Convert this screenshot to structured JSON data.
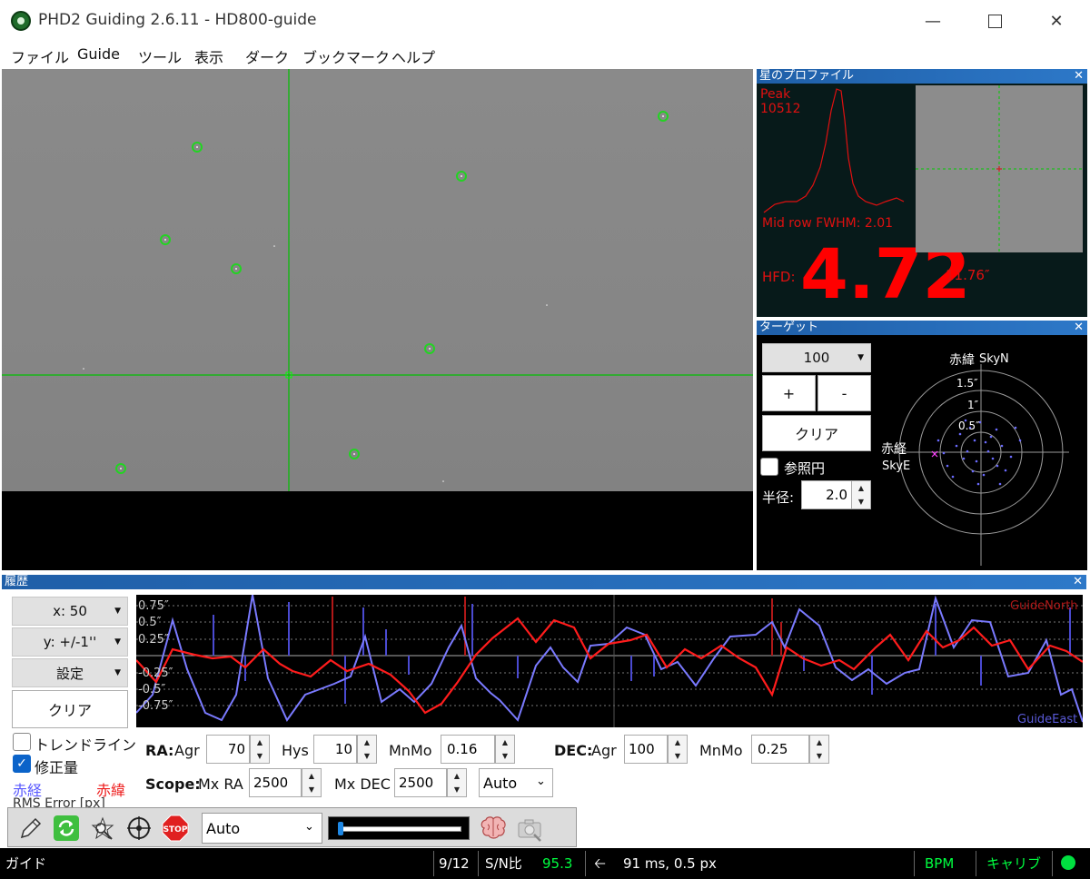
{
  "window": {
    "title": "PHD2 Guiding 2.6.11 - HD800-guide"
  },
  "menu": [
    "ファイル",
    "Guide",
    "ツール",
    "表示",
    "ダーク",
    "ブックマーク",
    "ヘルプ"
  ],
  "profile": {
    "title": "星のプロファイル",
    "peak_label": "Peak",
    "peak_value": "10512",
    "fwhm_text": "Mid row FWHM: 2.01",
    "hfd_label": "HFD:",
    "hfd_value": "4.72",
    "hfd_arcsec": "11.76″"
  },
  "target": {
    "title": "ターゲット",
    "zoom_value": "100",
    "plus_label": "+",
    "minus_label": "-",
    "clear_label": "クリア",
    "reference_circle_label": "参照円",
    "radius_label": "半径:",
    "radius_value": "2.0",
    "dec_axis_label": "赤緯",
    "skyn_label": "SkyN",
    "ra_axis_label": "赤経",
    "skye_label": "SkyE",
    "ring_labels": [
      "1.5″",
      "1″",
      "0.5″"
    ]
  },
  "history": {
    "title": "履歴",
    "x_scale": "x: 50",
    "y_scale": "y: +/-1''",
    "settings_label": "設定",
    "clear_label": "クリア",
    "trendline_label": "トレンドライン",
    "corrections_label": "修正量",
    "ra_legend": "赤経",
    "dec_legend": "赤緯",
    "rms_text": "RMS Error [px]",
    "y_ticks": [
      "0.75″",
      "0.5″",
      "0.25″",
      "-0.25″",
      "-0.5″",
      "-0.75″"
    ],
    "guide_north": "GuideNorth",
    "guide_east": "GuideEast"
  },
  "params": {
    "ra_label": "RA:",
    "ra_agr_label": "Agr",
    "ra_agr": "70",
    "hys_label": "Hys",
    "hys": "10",
    "ra_mnmo_label": "MnMo",
    "ra_mnmo": "0.16",
    "dec_label": "DEC:",
    "dec_agr_label": "Agr",
    "dec_agr": "100",
    "dec_mnmo_label": "MnMo",
    "dec_mnmo": "0.25",
    "scope_label": "Scope:",
    "mx_ra_label": "Mx RA",
    "mx_ra": "2500",
    "mx_dec_label": "Mx DEC",
    "mx_dec": "2500",
    "dec_mode": "Auto"
  },
  "toolbar": {
    "exposure": "Auto",
    "gamma_level": 0.03
  },
  "status": {
    "state": "ガイド",
    "frame": "9/12",
    "snr_label": "S/N比",
    "snr_value": "95.3",
    "guide_info": "91 ms, 0.5 px",
    "bpm": "BPM",
    "calib": "キャリブ"
  },
  "colors": {
    "ra": "#6666ff",
    "dec": "#ff2020",
    "accent": "#2d78c8",
    "crosshair": "#00c000",
    "status_green": "#00ff40"
  }
}
